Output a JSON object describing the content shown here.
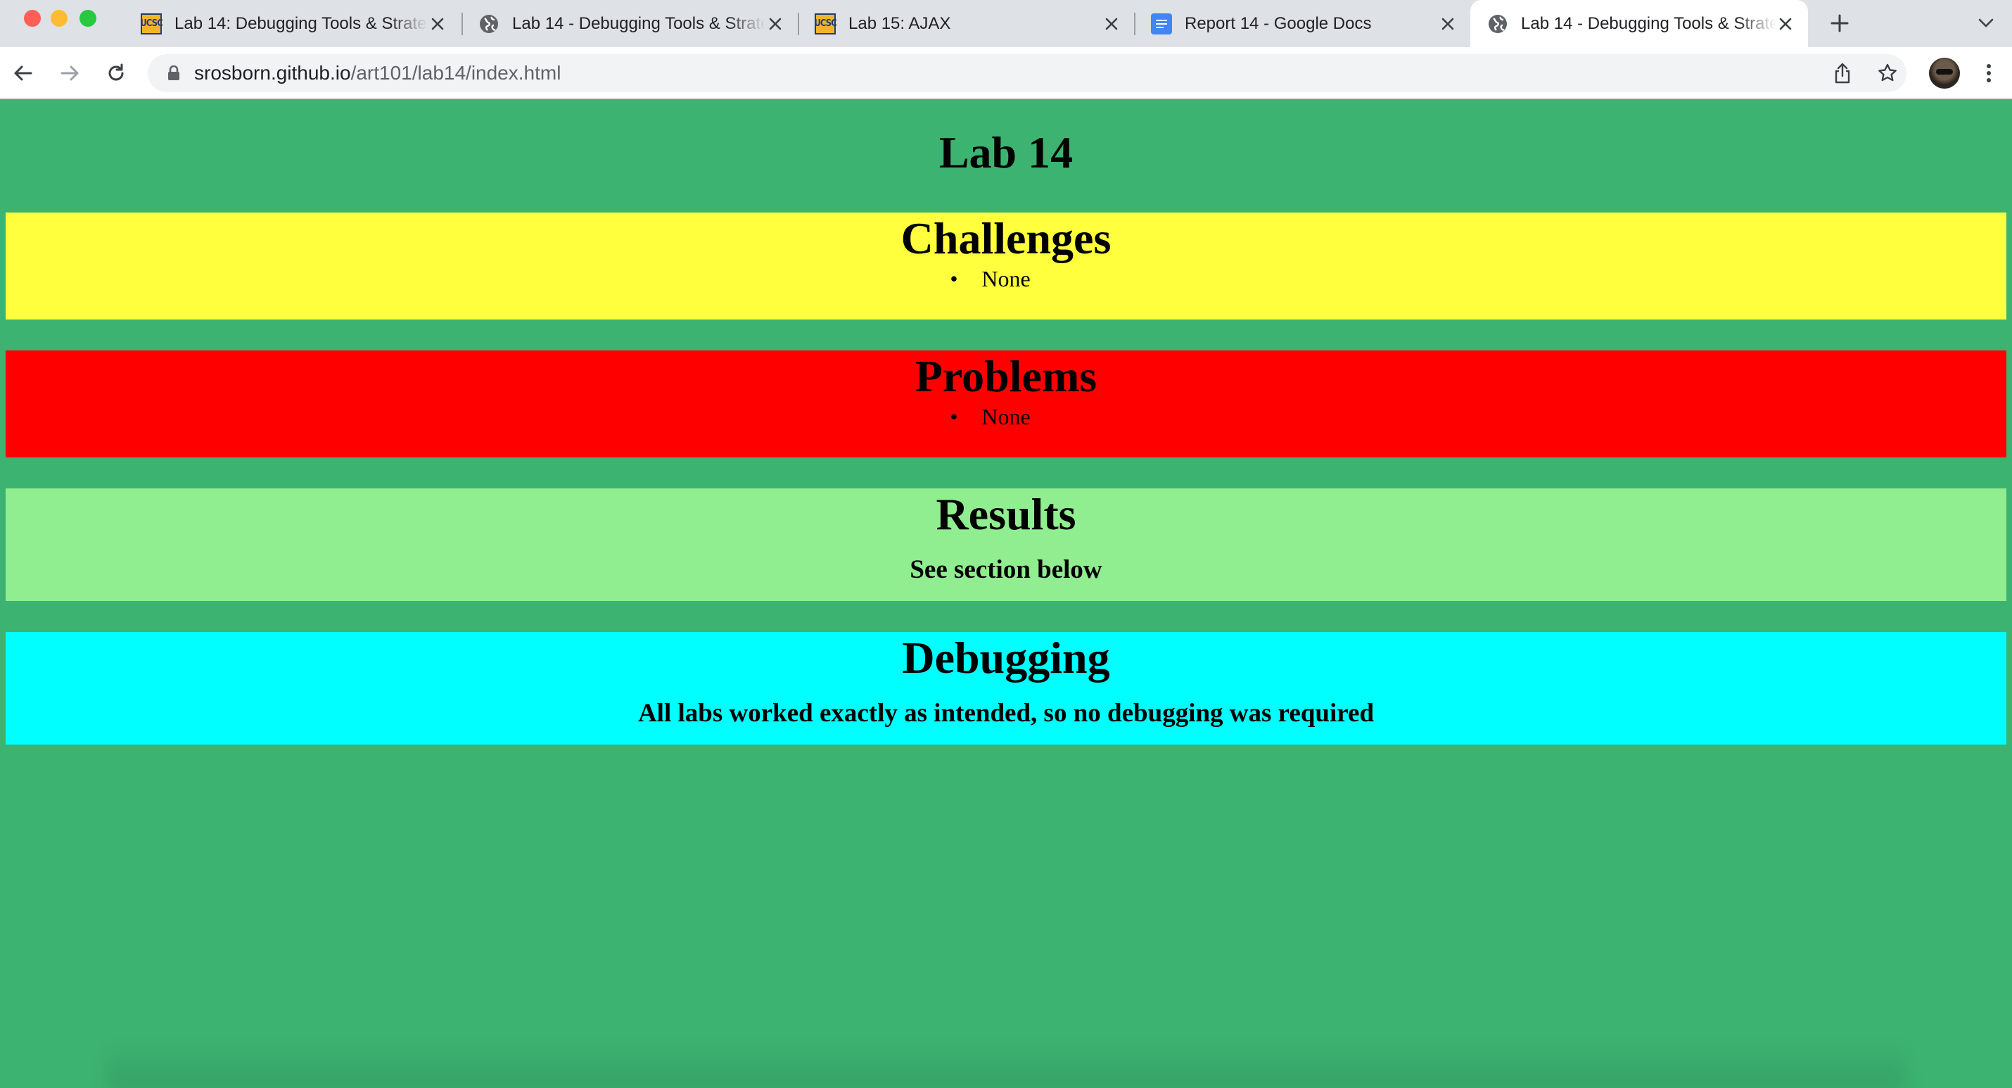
{
  "browser": {
    "tabs": [
      {
        "title": "Lab 14: Debugging Tools & Strategies",
        "favicon": "ucsc-icon",
        "active": false
      },
      {
        "title": "Lab 14 - Debugging Tools & Strategies",
        "favicon": "globe-icon",
        "active": false
      },
      {
        "title": "Lab 15: AJAX",
        "favicon": "ucsc-icon",
        "active": false
      },
      {
        "title": "Report 14 - Google Docs",
        "favicon": "google-docs-icon",
        "active": false
      },
      {
        "title": "Lab 14 - Debugging Tools & Strategies",
        "favicon": "globe-icon",
        "active": true
      }
    ],
    "address": {
      "host": "srosborn.github.io",
      "path": "/art101/lab14/index.html"
    },
    "ucsc_favicon_text": "UCSC"
  },
  "page": {
    "title": "Lab 14",
    "background": "#3cb371",
    "sections": {
      "challenges": {
        "heading": "Challenges",
        "items": [
          "None"
        ],
        "color": "#ffff3d"
      },
      "problems": {
        "heading": "Problems",
        "items": [
          "None"
        ],
        "color": "#ff0000"
      },
      "results": {
        "heading": "Results",
        "text": "See section below",
        "color": "#90ee90"
      },
      "debugging": {
        "heading": "Debugging",
        "text": "All labs worked exactly as intended, so no debugging was required",
        "color": "#00ffff"
      }
    }
  }
}
